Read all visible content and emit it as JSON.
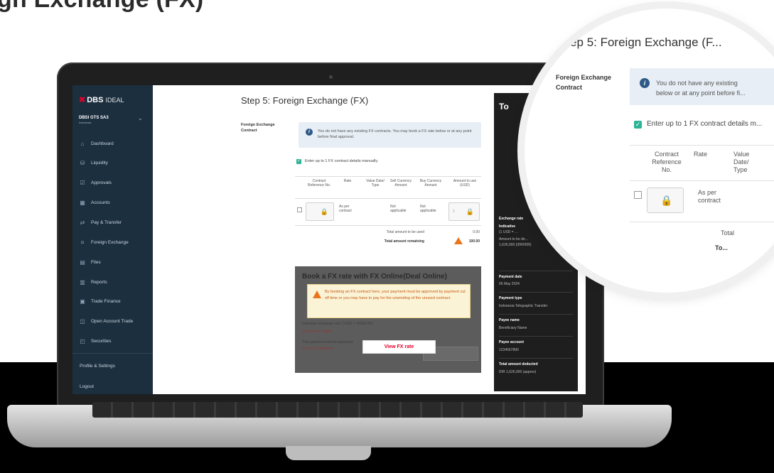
{
  "heading": "gn Exchange (FX)",
  "app": {
    "brand_mark": "✖",
    "brand_name": "DBS",
    "brand_suffix": "IDEAL",
    "org_name": "DBSI GTS SA3",
    "org_country": "Indonesia"
  },
  "sidebar": {
    "items": [
      {
        "icon": "home-icon",
        "glyph": "⌂",
        "label": "Dashboard"
      },
      {
        "icon": "liquidity-icon",
        "glyph": "⛁",
        "label": "Liquidity"
      },
      {
        "icon": "approvals-icon",
        "glyph": "☑",
        "label": "Approvals"
      },
      {
        "icon": "accounts-icon",
        "glyph": "▦",
        "label": "Accounts"
      },
      {
        "icon": "pay-transfer-icon",
        "glyph": "⇄",
        "label": "Pay & Transfer"
      },
      {
        "icon": "foreign-exchange-icon",
        "glyph": "¤",
        "label": "Foreign Exchange"
      },
      {
        "icon": "files-icon",
        "glyph": "▤",
        "label": "Files"
      },
      {
        "icon": "reports-icon",
        "glyph": "▥",
        "label": "Reports"
      },
      {
        "icon": "trade-finance-icon",
        "glyph": "▣",
        "label": "Trade Finance"
      },
      {
        "icon": "open-account-trade-icon",
        "glyph": "◫",
        "label": "Open Account Trade"
      },
      {
        "icon": "securities-icon",
        "glyph": "◰",
        "label": "Securities"
      }
    ],
    "profile": "Profile & Settings",
    "logout": "Logout"
  },
  "main": {
    "step_title": "Step 5: Foreign Exchange (FX)",
    "fx_contract_label_1": "Foreign Exchange",
    "fx_contract_label_2": "Contract",
    "info_text": "You do not have any existing FX contracts. You may book a FX rate below or at any point before final approval.",
    "manual_entry_label": "Enter up to 1 FX contract details manually.",
    "table": {
      "headers": [
        "Contract Reference No.",
        "Rate",
        "Value Date/ Type",
        "Sell Currency Amount",
        "Buy Currency Amount",
        "Amount to use (USD)"
      ],
      "row": {
        "rate": "As per contract",
        "sell": "Not applicable",
        "buy": "Not applicable",
        "amount": "0"
      },
      "total_used_label": "Total amount to be used",
      "total_used_value": "0.00",
      "total_remaining_label": "Total amount remaining",
      "total_remaining_value": "100.00"
    },
    "fx_online": {
      "title": "Book a FX rate with FX Online(Deal Online)",
      "warning": "By booking an FX contract here, your payment must be approved by payment cut off time or you may have to pay for the unwinding of the unused contract.",
      "indicative": "Indicative exchange rate 1 USD = 16260 IDR",
      "show_more": "Show more details",
      "terms_prefix": "This payment must be approved",
      "terms_link": "Terms & Conditions",
      "view_rate_button": "View FX rate"
    }
  },
  "summary": {
    "title": "To",
    "fields": [
      {
        "label": "Exchange rate",
        "value": ""
      },
      {
        "label": "Indicative",
        "value": "(1 USD = ..."
      },
      {
        "label": "Amount to ...",
        "value": "Amount to be de... 1,626,000 (IDR/IDR)"
      },
      {
        "label": "Payment date",
        "value": "06 May 2024"
      },
      {
        "label": "Payment type",
        "value": "Indonesia Telegraphic Transfer"
      },
      {
        "label": "Payee name",
        "value": "Beneficiary Name"
      },
      {
        "label": "Payee account",
        "value": "1234567890"
      },
      {
        "label": "Total amount deducted",
        "value": "IDR 1,626,000 (approx)"
      }
    ]
  },
  "magnifier": {
    "title": "Step 5: Foreign Exchange (F...",
    "fx_label_1": "Foreign Exchange",
    "fx_label_2": "Contract",
    "info_line_1": "You do not have any existing",
    "info_line_2": "below or at any point before fi...",
    "manual_entry_label": "Enter up to 1 FX contract details m...",
    "headers": [
      "Contract Reference No.",
      "Rate",
      "Value Date/ Type"
    ],
    "rate": "As per contract",
    "total_1": "Total",
    "total_2": "To..."
  }
}
